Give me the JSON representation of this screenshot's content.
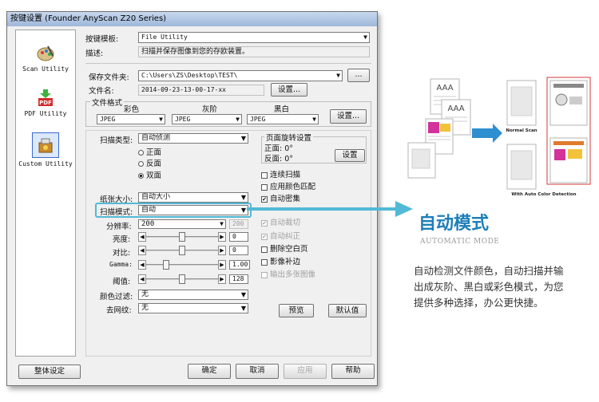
{
  "window": {
    "title": "按键设置 (Founder AnyScan Z20 Series)"
  },
  "sidebar": {
    "items": [
      {
        "label": "Scan Utility",
        "icon": "paint-palette-icon"
      },
      {
        "label": "PDF Utility",
        "icon": "pdf-icon"
      },
      {
        "label": "Custom Utility",
        "icon": "custom-tool-icon"
      }
    ]
  },
  "template": {
    "label": "按键模板:",
    "value": "File Utility"
  },
  "description": {
    "label": "描述:",
    "value": "扫描并保存图像到您的存欧装置。"
  },
  "save_folder": {
    "label": "保存文件夹:",
    "value": "C:\\Users\\ZS\\Desktop\\TEST\\",
    "browse": "..."
  },
  "file_name": {
    "label": "文件名:",
    "value": "2014-09-23-13-00-17-xx",
    "settings": "设置..."
  },
  "file_format": {
    "title": "文件格式",
    "color_label": "彩色",
    "color_value": "JPEG",
    "gray_label": "灰阶",
    "gray_value": "JPEG",
    "bw_label": "黑白",
    "bw_value": "JPEG",
    "settings": "设置..."
  },
  "scan_type": {
    "label": "扫描类型:",
    "value": "自动侦测",
    "options": [
      "正面",
      "反面",
      "双面"
    ],
    "selected": 2
  },
  "rotation": {
    "title": "页面旋转设置",
    "front": "正面: 0°",
    "back": "反面: 0°",
    "settings": "设置"
  },
  "checkboxes": [
    {
      "label": "连续扫描",
      "checked": false,
      "enabled": true
    },
    {
      "label": "应用颜色匹配",
      "checked": false,
      "enabled": true
    },
    {
      "label": "自动密集",
      "checked": true,
      "enabled": true
    },
    {
      "label": "自动裁切",
      "checked": true,
      "enabled": false
    },
    {
      "label": "自动纠正",
      "checked": true,
      "enabled": false
    },
    {
      "label": "删除空白页",
      "checked": false,
      "enabled": true
    },
    {
      "label": "影像补边",
      "checked": false,
      "enabled": true
    },
    {
      "label": "输出多张图像",
      "checked": false,
      "enabled": false
    }
  ],
  "paper_size": {
    "label": "纸张大小:",
    "value": "自动大小"
  },
  "scan_mode": {
    "label": "扫描模式:",
    "value": "自动"
  },
  "resolution": {
    "label": "分辨率:",
    "value": "200",
    "value2": "200"
  },
  "brightness": {
    "label": "亮度:",
    "value": "0",
    "level": 0.5
  },
  "contrast": {
    "label": "对比:",
    "value": "0",
    "level": 0.5
  },
  "gamma": {
    "label": "Gamma:",
    "value": "1.00",
    "level": 0.25
  },
  "threshold": {
    "label": "阈值:",
    "value": "128",
    "level": 0.5
  },
  "color_filter": {
    "label": "颜色过滤:",
    "value": "无"
  },
  "descreen": {
    "label": "去网纹:",
    "value": "无"
  },
  "buttons": {
    "preview": "预览",
    "default": "默认值",
    "global": "整体设定",
    "ok": "确定",
    "cancel": "取消",
    "apply": "应用",
    "help": "帮助"
  },
  "promo": {
    "heading": "自动模式",
    "subheading": "AUTOMATIC MODE",
    "body_line1": "自动检测文件颜色，自动扫描并输",
    "body_line2": "出成灰阶、黑白或彩色模式，为您",
    "body_line3": "提供多种选择，办公更快捷。",
    "doc_text": "AAA",
    "normal_scan": "Normal Scan",
    "auto_color": "With Auto Color Detection",
    "accent": "#1d7fb8",
    "highlight_color": "#52b9d6",
    "frame_color": "#d63a3a"
  }
}
